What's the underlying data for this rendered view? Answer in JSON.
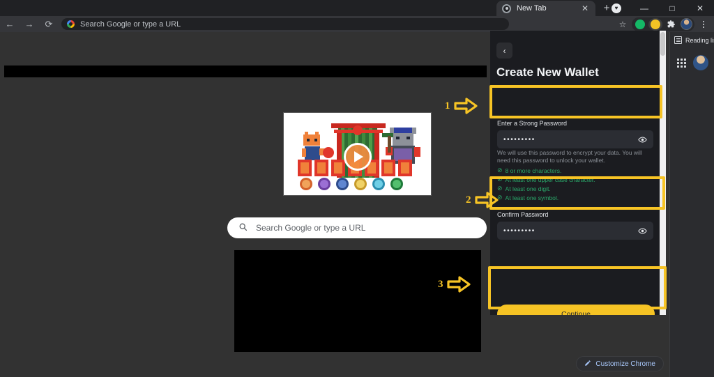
{
  "browser": {
    "tab": {
      "title": "New Tab",
      "favicon": "target-circle-icon",
      "close_icon": "✕"
    },
    "new_tab_button": "+",
    "window_controls": {
      "minimize": "—",
      "maximize": "□",
      "close": "✕",
      "heart": "♥"
    },
    "toolbar": {
      "back_icon": "←",
      "forward_icon": "→",
      "reload_icon": "⟳",
      "omnibox_placeholder": "Search Google or type a URL",
      "bookmark_icon": "☆",
      "extensions_icon": "puzzle-piece-icon",
      "menu_icon": "kebab-menu-icon"
    }
  },
  "side_panel": {
    "reading_list_label": "Reading list",
    "apps_grid_icon": "apps-grid-icon",
    "profile_avatar": "profile-avatar-icon"
  },
  "newtab": {
    "doodle_alt": "Google Doodle Champion Island Games",
    "search_placeholder": "Search Google or type a URL",
    "search_icon": "search-icon",
    "customize_label": "Customize Chrome",
    "customize_icon": "pencil-icon"
  },
  "wallet": {
    "back_icon": "‹",
    "title": "Create New Wallet",
    "password_field": {
      "label": "Enter a Strong Password",
      "value": "•••••••••",
      "reveal_icon": "eye-icon"
    },
    "help_text": "We will use this password to encrypt your data. You will need this password to unlock your wallet.",
    "requirements": [
      {
        "check": "⊘",
        "text": "8 or more characters."
      },
      {
        "check": "⊘",
        "text": "At least one upper case character."
      },
      {
        "check": "⊘",
        "text": "At least one digit."
      },
      {
        "check": "⊘",
        "text": "At least one symbol."
      }
    ],
    "confirm_field": {
      "label": "Confirm Password",
      "value": "•••••••••",
      "reveal_icon": "eye-icon"
    },
    "continue_label": "Continue"
  },
  "annotations": [
    {
      "number": "1",
      "target": "password-field"
    },
    {
      "number": "2",
      "target": "confirm-password-field"
    },
    {
      "number": "3",
      "target": "continue-button"
    }
  ],
  "colors": {
    "highlight": "#f7c425",
    "accent_button": "#f5c324",
    "requirement_met": "#2aa86a",
    "panel_bg": "#1b1c20",
    "page_bg": "#323232"
  }
}
